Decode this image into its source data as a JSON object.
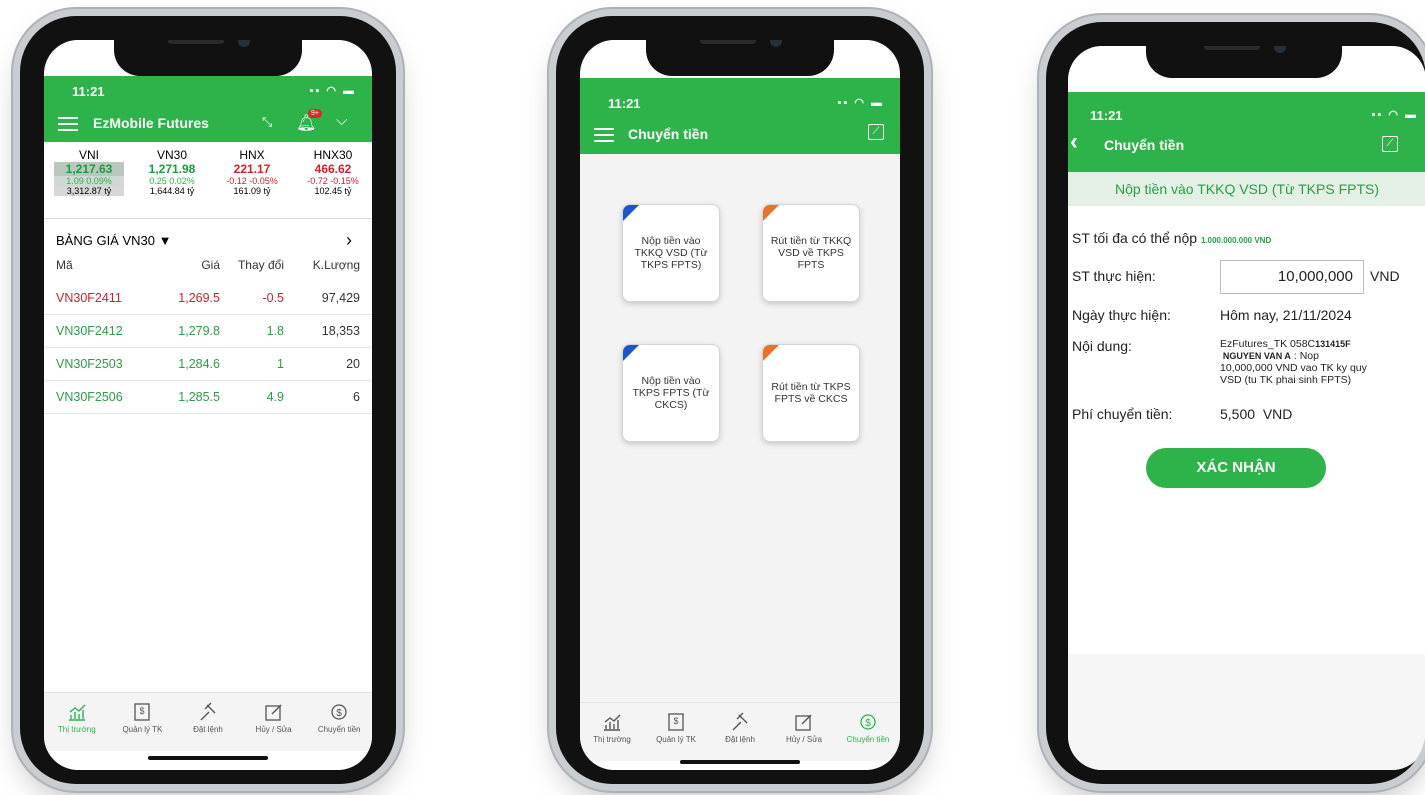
{
  "phone1": {
    "time": "11:21",
    "title": "EzMobile Futures",
    "bell_badge": "9+",
    "indices": [
      {
        "name": "VNI",
        "value": "1,217.63",
        "change": "1.09",
        "pct": "0.09%",
        "volume": "3,312.87 tỷ"
      },
      {
        "name": "VN30",
        "value": "1,271.98",
        "change": "0.25",
        "pct": "0.02%",
        "volume": "1,644.84 tỷ"
      },
      {
        "name": "HNX",
        "value": "221.17",
        "change": "-0.12",
        "pct": "-0.05%",
        "volume": "161.09 tỷ"
      },
      {
        "name": "HNX30",
        "value": "466.62",
        "change": "-0.72",
        "pct": "-0.15%",
        "volume": "102.45 tỷ"
      }
    ],
    "board_title": "BẢNG GIÁ VN30",
    "columns": [
      "Mã",
      "Giá",
      "Thay đổi",
      "K.Lượng"
    ],
    "rows": [
      {
        "code": "VN30F2411",
        "price": "1,269.5",
        "change": "-0.5",
        "volume": "97,429"
      },
      {
        "code": "VN30F2412",
        "price": "1,279.8",
        "change": "1.8",
        "volume": "18,353"
      },
      {
        "code": "VN30F2503",
        "price": "1,284.6",
        "change": "1",
        "volume": "20"
      },
      {
        "code": "VN30F2506",
        "price": "1,285.5",
        "change": "4.9",
        "volume": "6"
      }
    ],
    "tabs": [
      "Thị trường",
      "Quản lý TK",
      "Đặt lệnh",
      "Hủy / Sửa",
      "Chuyển tiền"
    ]
  },
  "phone2": {
    "time": "11:21",
    "title": "Chuyển tiền",
    "cards": [
      "Nộp tiền vào TKKQ VSD (Từ TKPS FPTS)",
      "Rút tiền từ TKKQ VSD về TKPS FPTS",
      "Nộp tiền vào TKPS FPTS (Từ CKCS)",
      "Rút tiền từ TKPS FPTS về CKCS"
    ],
    "tabs": [
      "Thị trường",
      "Quản lý TK",
      "Đặt lệnh",
      "Hủy / Sửa",
      "Chuyển tiền"
    ]
  },
  "phone3": {
    "time": "11:21",
    "title": "Chuyển tiền",
    "subtitle": "Nộp tiền vào TKKQ VSD (Từ TKPS FPTS)",
    "max_label": "ST tối đa có thể nộp",
    "max_value": "1.000.000.000 VND",
    "amount_label": "ST thực hiện:",
    "amount_value": "10,000,000",
    "amount_unit": "VND",
    "date_label": "Ngày thực hiện:",
    "date_value": "Hôm nay, 21/11/2024",
    "content_label": "Nội dung:",
    "content_line1a": "EzFutures_TK 058C",
    "content_line1b": "131415F",
    "content_line2a": "NGUYEN VAN A",
    "content_line2b": " : Nop",
    "content_line3": "10,000,000 VND vao TK ky quy",
    "content_line4": "VSD (tu TK phai sinh FPTS)",
    "fee_label": "Phí chuyển tiền:",
    "fee_value": "5,500  VND",
    "confirm": "XÁC NHẬN"
  }
}
